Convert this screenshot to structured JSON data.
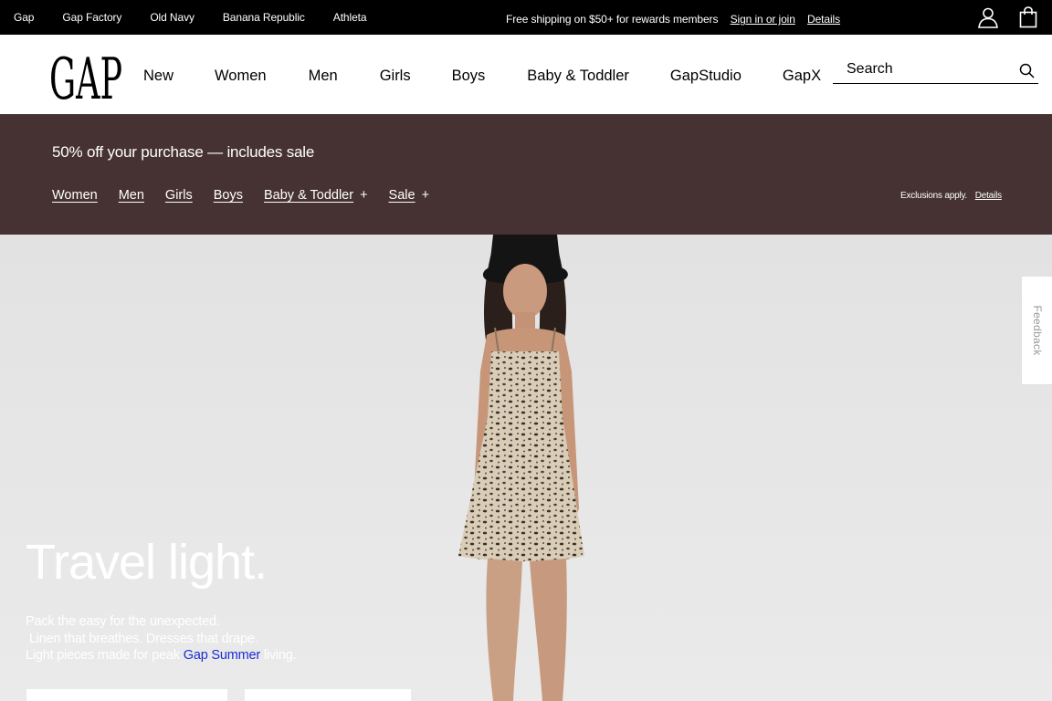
{
  "brand_bar": {
    "links": [
      "Gap",
      "Gap Factory",
      "Old Navy",
      "Banana Republic",
      "Athleta"
    ]
  },
  "shipping_promo": {
    "text": "Free shipping on $50+ for rewards members",
    "sign_in": "Sign in or join",
    "details": "Details"
  },
  "account_icon": "person-icon",
  "bag_icon": "shopping-bag-icon",
  "logo_text": "GAP",
  "nav": {
    "items": [
      "New",
      "Women",
      "Men",
      "Girls",
      "Boys",
      "Baby & Toddler",
      "GapStudio",
      "GapX"
    ]
  },
  "search": {
    "placeholder": "Search",
    "icon": "search-icon"
  },
  "banner": {
    "title": "50% off your purchase — includes sale",
    "links": [
      "Women",
      "Men",
      "Girls",
      "Boys",
      "Baby & Toddler",
      "Sale"
    ],
    "plus": "+",
    "exclusions": "Exclusions apply.",
    "details": "Details",
    "background": "#463232"
  },
  "hero": {
    "headline": "Travel light.",
    "line1": "Pack the easy for the unexpected.",
    "line2": " Linen that breathes. Dresses that drape.",
    "line3_pre": "Light pieces made for peak ",
    "line3_link": "Gap Summer",
    "line3_post": " living.",
    "link_color": "#1b2bd6"
  },
  "feedback": {
    "label": "Feedback"
  }
}
